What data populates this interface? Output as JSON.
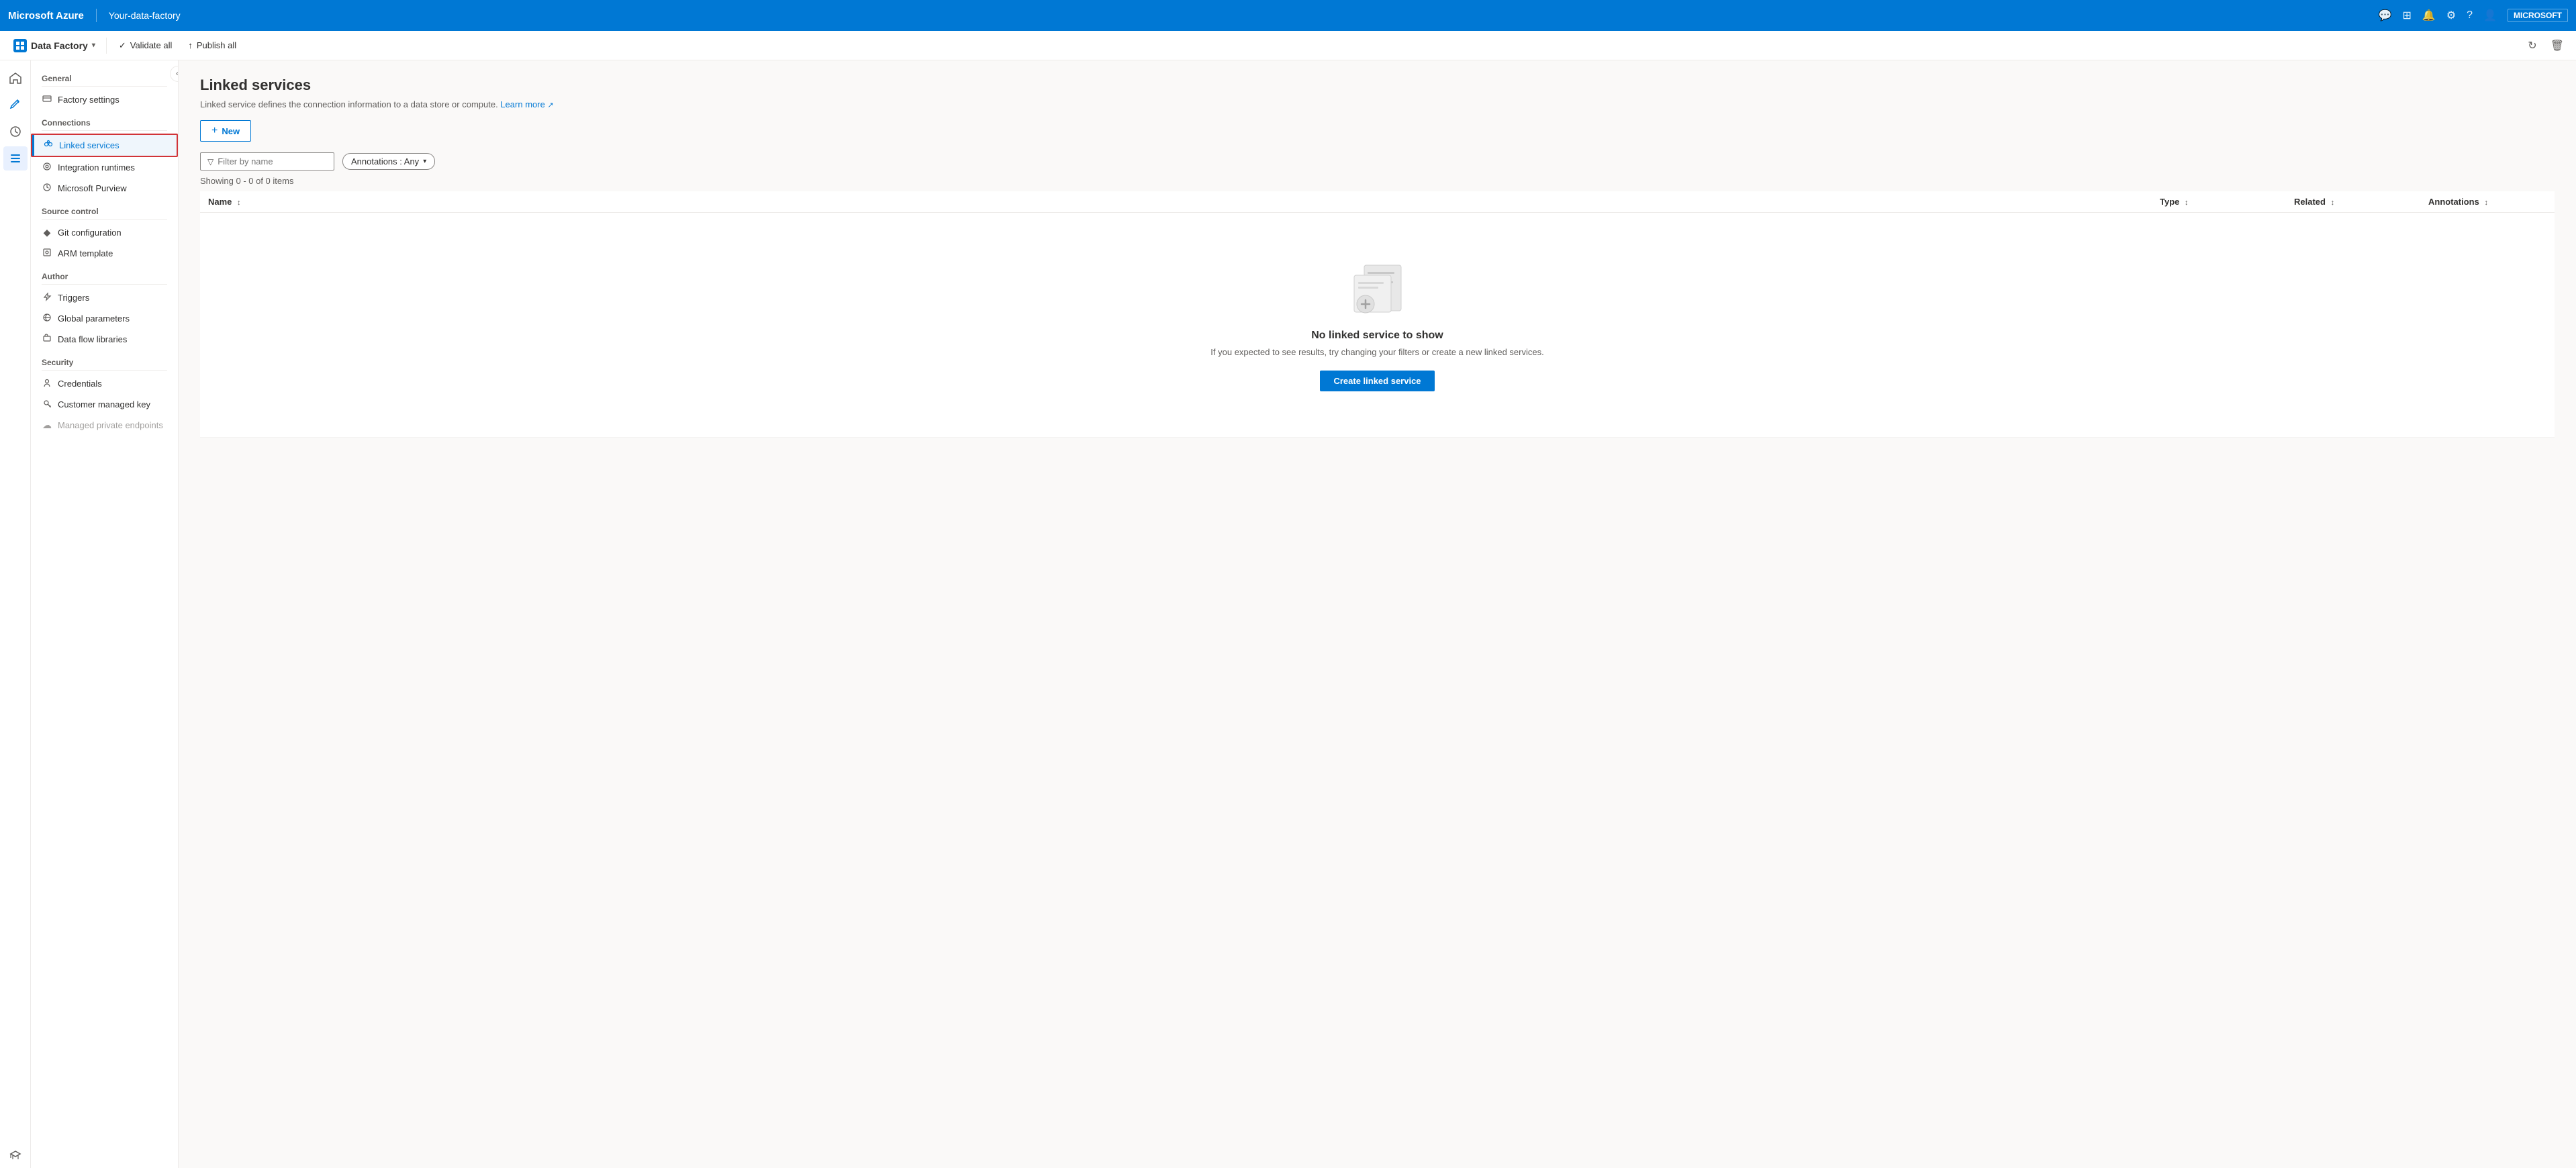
{
  "topbar": {
    "brand": "Microsoft Azure",
    "factory_name": "Your-data-factory",
    "company": "MICROSOFT"
  },
  "toolbar": {
    "df_label": "Data Factory",
    "validate_all": "Validate all",
    "publish_all": "Publish all"
  },
  "nav": {
    "collapse_btn": "«",
    "general_label": "General",
    "factory_settings": "Factory settings",
    "connections_label": "Connections",
    "linked_services": "Linked services",
    "integration_runtimes": "Integration runtimes",
    "microsoft_purview": "Microsoft Purview",
    "source_control_label": "Source control",
    "git_configuration": "Git configuration",
    "arm_template": "ARM template",
    "author_label": "Author",
    "triggers": "Triggers",
    "global_parameters": "Global parameters",
    "data_flow_libraries": "Data flow libraries",
    "security_label": "Security",
    "credentials": "Credentials",
    "customer_managed_key": "Customer managed key",
    "managed_private_endpoints": "Managed private endpoints"
  },
  "content": {
    "page_title": "Linked services",
    "description": "Linked service defines the connection information to a data store or compute.",
    "learn_more": "Learn more",
    "new_btn": "New",
    "filter_placeholder": "Filter by name",
    "annotations_label": "Annotations : Any",
    "showing_count": "Showing 0 - 0 of 0 items",
    "col_name": "Name",
    "col_type": "Type",
    "col_related": "Related",
    "col_annotations": "Annotations",
    "empty_title": "No linked service to show",
    "empty_desc": "If you expected to see results, try changing your filters or create a new linked services.",
    "create_btn": "Create linked service"
  }
}
